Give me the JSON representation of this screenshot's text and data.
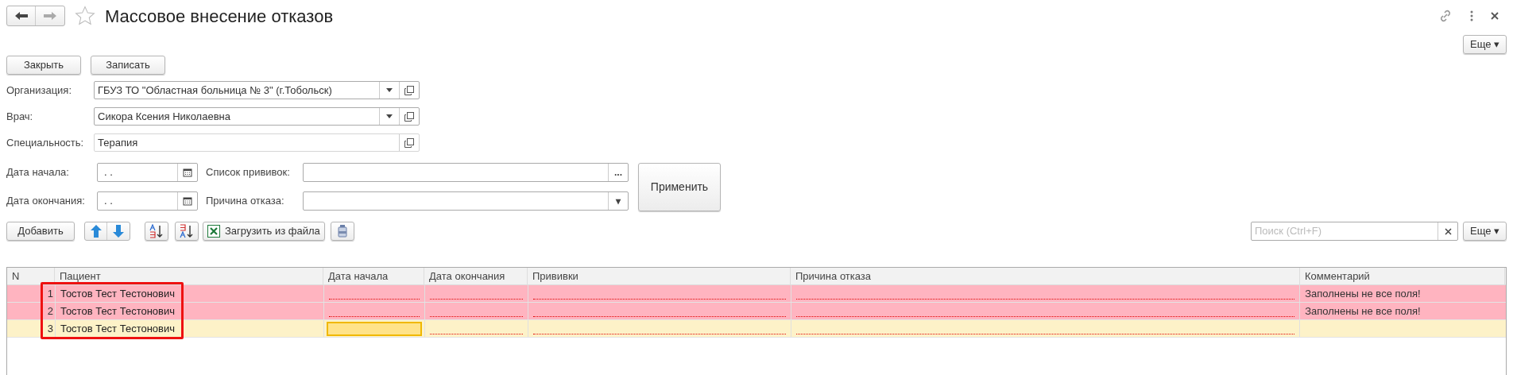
{
  "window": {
    "title": "Массовое внесение отказов"
  },
  "more_top": "Еще ▾",
  "actions": [
    "Закрыть",
    "Записать"
  ],
  "fields": [
    {
      "label": "Организация:",
      "value": "ГБУЗ ТО \"Областная больница № 3\" (г.Тобольск)",
      "dropdown": true
    },
    {
      "label": "Врач:",
      "value": "Сикора Ксения Николаевна",
      "dropdown": true
    },
    {
      "label": "Специальность:",
      "value": "Терапия",
      "dropdown": false
    }
  ],
  "filters_left": [
    {
      "label": "Дата начала:",
      "value": ". ."
    },
    {
      "label": "Дата окончания:",
      "value": ". ."
    }
  ],
  "filters_right": [
    {
      "label": "Список прививок:",
      "button": "..."
    },
    {
      "label": "Причина отказа:",
      "button": "▾"
    }
  ],
  "apply": "Применить",
  "toolbar": {
    "add": "Добавить",
    "load": "Загрузить из файла",
    "search_placeholder": "Поиск (Ctrl+F)",
    "more": "Еще ▾"
  },
  "table": {
    "columns": [
      "N",
      "Пациент",
      "Дата начала",
      "Дата окончания",
      "Прививки",
      "Причина отказа",
      "Комментарий"
    ],
    "patient_frame": true,
    "rows": [
      {
        "n": "1",
        "patient": "Тостов Тест Тестонович",
        "error": true,
        "selected": false,
        "comment": "Заполнены не все поля!",
        "cells": [
          {
            "required": true,
            "focused": false
          },
          {
            "required": true,
            "focused": false
          },
          {
            "required": true,
            "focused": false
          },
          {
            "required": true,
            "focused": false
          }
        ]
      },
      {
        "n": "2",
        "patient": "Тостов Тест Тестонович",
        "error": true,
        "selected": false,
        "comment": "Заполнены не все поля!",
        "cells": [
          {
            "required": true,
            "focused": false
          },
          {
            "required": true,
            "focused": false
          },
          {
            "required": true,
            "focused": false
          },
          {
            "required": true,
            "focused": false
          }
        ]
      },
      {
        "n": "3",
        "patient": "Тостов Тест Тестонович",
        "error": false,
        "selected": true,
        "cells": [
          {
            "required": false,
            "focused": true
          },
          {
            "required": true,
            "focused": false
          },
          {
            "required": true,
            "focused": false
          },
          {
            "required": true,
            "focused": false
          }
        ]
      }
    ]
  }
}
